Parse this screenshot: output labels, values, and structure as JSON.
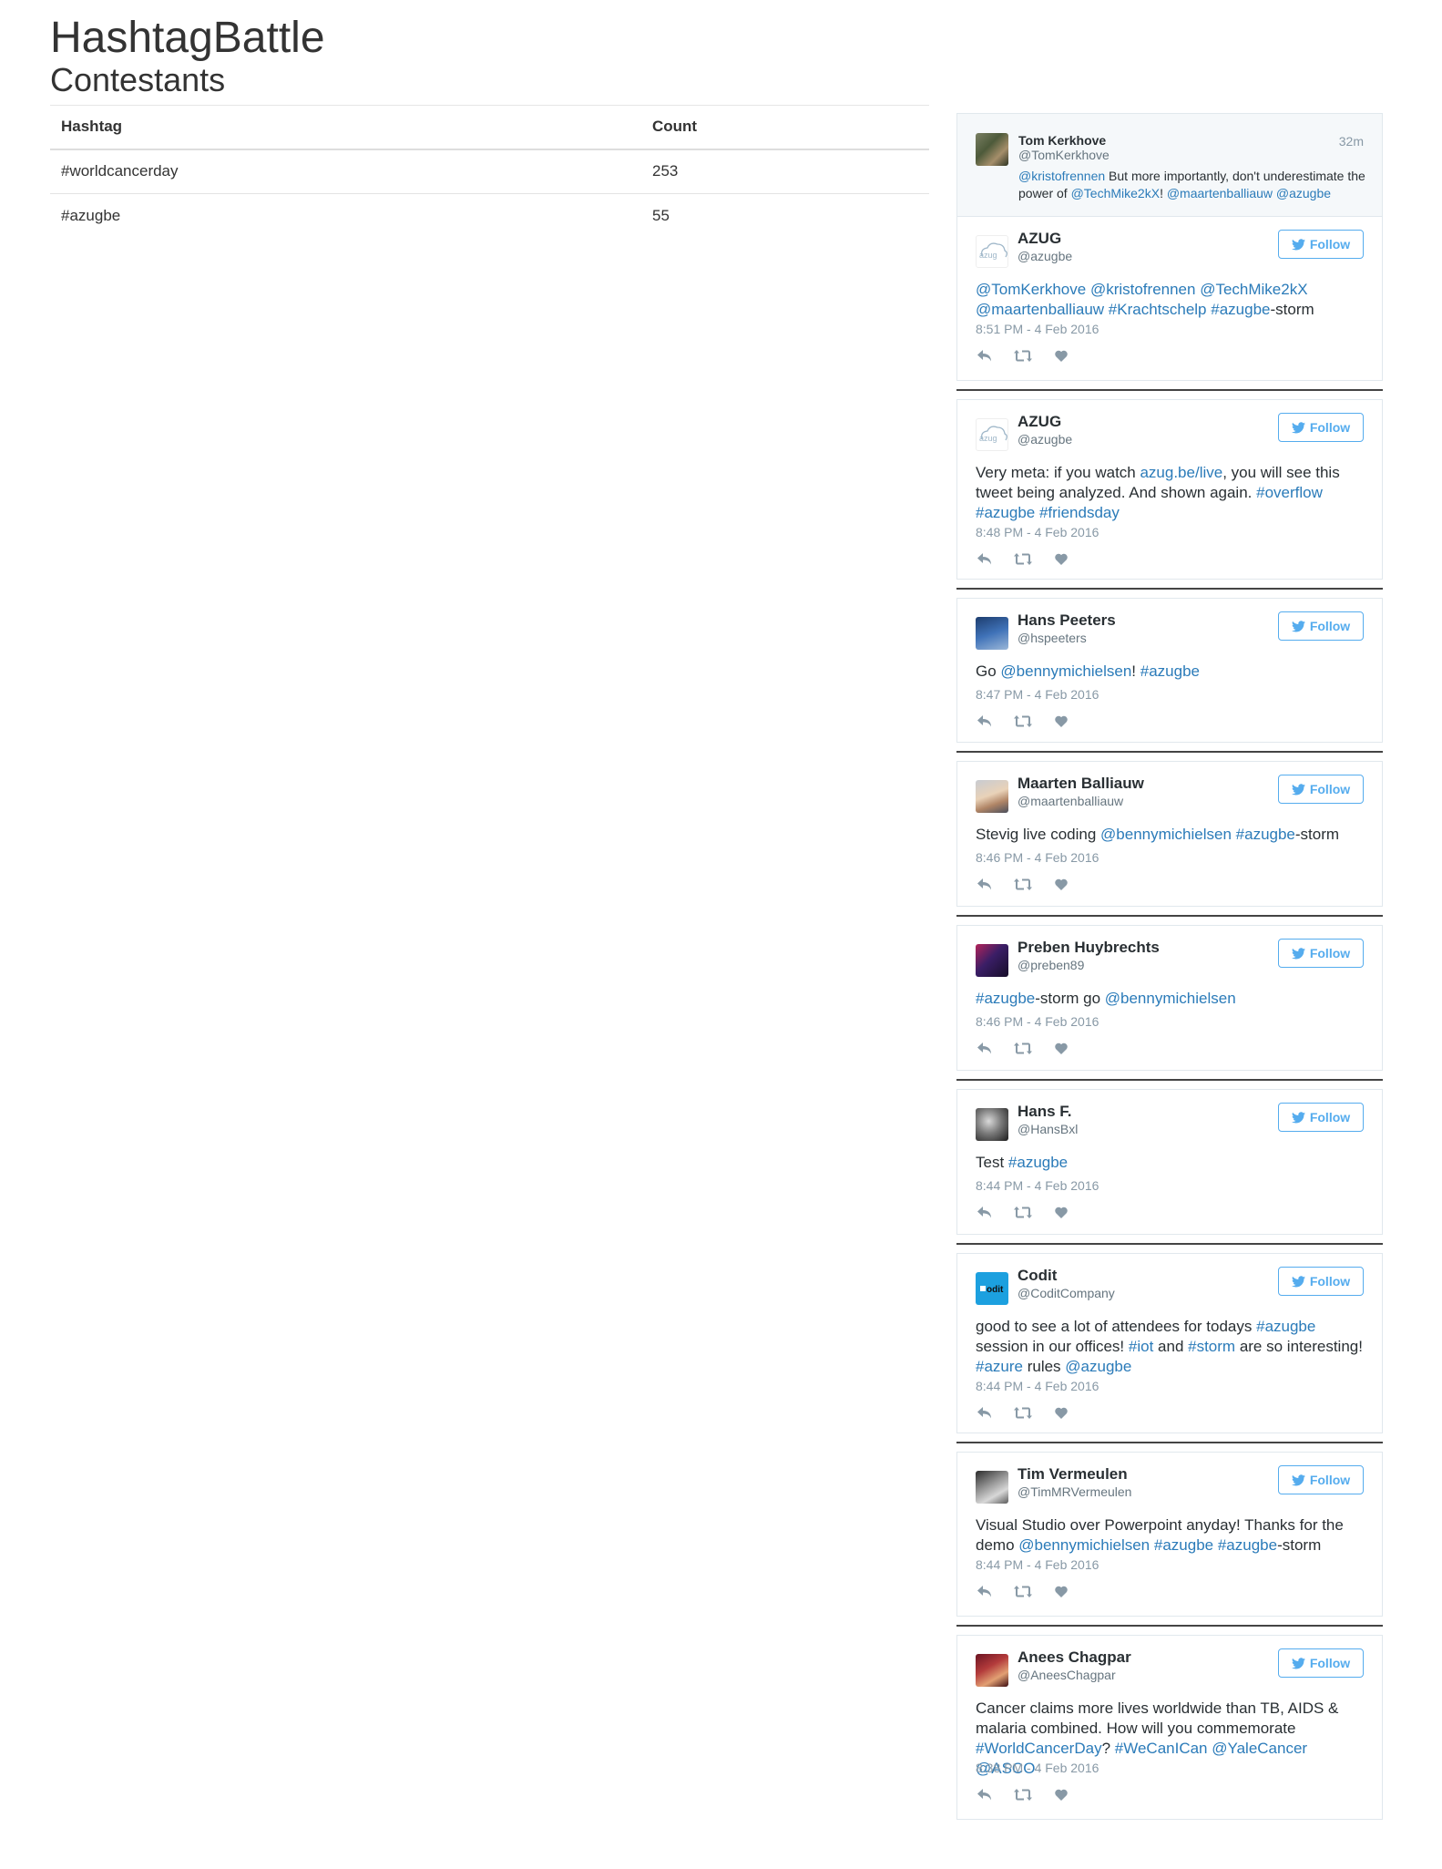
{
  "page": {
    "title": "HashtagBattle",
    "subtitle": "Contestants"
  },
  "contestants": {
    "headers": [
      "Hashtag",
      "Count"
    ],
    "rows": [
      {
        "hashtag": "#worldcancerday",
        "count": "253"
      },
      {
        "hashtag": "#azugbe",
        "count": "55"
      }
    ]
  },
  "feed": {
    "follow_label": "Follow",
    "first": {
      "name": "Tom Kerkhove",
      "handle": "@TomKerkhove",
      "time": "32m",
      "t1": "@kristofrennen",
      "t2": " But more importantly, don't underestimate the power of ",
      "t3": "@TechMike2kX",
      "t4": "! ",
      "t5": "@maartenballiauw",
      "t6": " ",
      "t7": "@azugbe"
    },
    "tweets": [
      {
        "name": "AZUG",
        "handle": "@azugbe",
        "date": "8:51 PM - 4 Feb 2016",
        "t1": "@TomKerkhove",
        "t2": " ",
        "t3": "@kristofrennen",
        "t4": " ",
        "t5": "@TechMike2kX",
        "t6": " ",
        "t7": "@maartenballiauw",
        "t8": " ",
        "t9": "#Krachtschelp",
        "t10": " ",
        "t11": "#azugbe",
        "t12": "-storm"
      },
      {
        "name": "AZUG",
        "handle": "@azugbe",
        "date": "8:48 PM - 4 Feb 2016",
        "t1": "Very meta: if you watch ",
        "t2": "azug.be/live",
        "t3": ", you will see this tweet being analyzed. And shown again. ",
        "t4": "#overflow",
        "t5": " ",
        "t6": "#azugbe",
        "t7": " ",
        "t8": "#friendsday"
      },
      {
        "name": "Hans Peeters",
        "handle": "@hspeeters",
        "date": "8:47 PM - 4 Feb 2016",
        "t1": "Go ",
        "t2": "@bennymichielsen",
        "t3": "! ",
        "t4": "#azugbe"
      },
      {
        "name": "Maarten Balliauw",
        "handle": "@maartenballiauw",
        "date": "8:46 PM - 4 Feb 2016",
        "t1": "Stevig live coding ",
        "t2": "@bennymichielsen",
        "t3": " ",
        "t4": "#azugbe",
        "t5": "-storm"
      },
      {
        "name": "Preben Huybrechts",
        "handle": "@preben89",
        "date": "8:46 PM - 4 Feb 2016",
        "t1": "#azugbe",
        "t2": "-storm go ",
        "t3": "@bennymichielsen"
      },
      {
        "name": "Hans F.",
        "handle": "@HansBxl",
        "date": "8:44 PM - 4 Feb 2016",
        "t1": "Test ",
        "t2": "#azugbe"
      },
      {
        "name": "Codit",
        "handle": "@CoditCompany",
        "date": "8:44 PM - 4 Feb 2016",
        "t1": "good to see a lot of attendees for todays ",
        "t2": "#azugbe",
        "t3": " session in our offices! ",
        "t4": "#iot",
        "t5": " and ",
        "t6": "#storm",
        "t7": " are so interesting! ",
        "t8": "#azure",
        "t9": " rules ",
        "t10": "@azugbe"
      },
      {
        "name": "Tim Vermeulen",
        "handle": "@TimMRVermeulen",
        "date": "8:44 PM - 4 Feb 2016",
        "t1": "Visual Studio over Powerpoint anyday! Thanks for the demo ",
        "t2": "@bennymichielsen",
        "t3": " ",
        "t4": "#azugbe",
        "t5": " ",
        "t6": "#azugbe",
        "t7": "-storm"
      },
      {
        "name": "Anees Chagpar",
        "handle": "@AneesChagpar",
        "date": "8:38 PM - 4 Feb 2016",
        "t1": "Cancer claims more lives worldwide than TB, AIDS & malaria combined. How will you commemorate ",
        "t2": "#WorldCancerDay",
        "t3": "? ",
        "t4": "#WeCanICan",
        "t5": " ",
        "t6": "@YaleCancer",
        "t7": " ",
        "t8": "@ASCO"
      }
    ],
    "avatar_text": {
      "azug": "azug",
      "codit": "odit"
    }
  },
  "colors": {
    "link": "#2b7bb9",
    "follow": "#55acee",
    "muted": "#8899a6"
  },
  "icons": [
    "reply-icon",
    "retweet-icon",
    "like-icon",
    "twitter-bird-icon"
  ]
}
